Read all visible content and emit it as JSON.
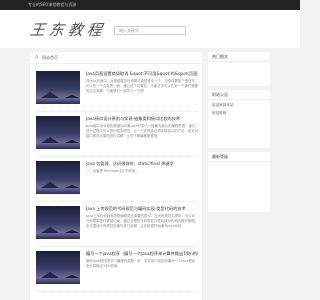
{
  "topbar": {
    "text": "专业的SEO课程教程与资源"
  },
  "header": {
    "logo": "王东教程",
    "search_placeholder": "输入关键字"
  },
  "breadcrumb": {
    "label": "网站首页"
  },
  "posts": [
    {
      "title": "Java页面设置商如取消 &quot;不可用&quot;的&quot;页面和&quot;按钮不能使用",
      "excerpt": "在Java页面中，对按钮框进行设置可能是其中一个，当你设置某个按钮不可以在一个交互的一面，通过这个设置后，不能点击可以达到一个我们想要的交互效果，下面我们一起学习一下吧"
    },
    {
      "title": "Java接口设计原则与实现-抽象类和接口比较的技术",
      "excerpt": "Java接口设计原则是面向对象Java开发中一种最为核心的编程思想，接口设计过程中可以进行很多规范，让一个实现类必须实现接口的方法，本文对接口的设计原则进行讲解，让你了解编程更规范。"
    },
    {
      "title": "java 包管理、访问修饰符、static/final 关键字",
      "excerpt": "一、包管理 Package(包) 的作用..."
    },
    {
      "title": "Java 上传规范的代码规范与编码实现-类型代码的技术",
      "excerpt": "Java上传的代码规范是编程语言重要的部分，在代码规范实现时，可以对代码框架进行规范约束，通过合理的代码规范方便后续对代码的维护管理。本文围绕代码规范的编写进行讲解，让你能更好地编写Java代码。"
    },
    {
      "title": "编写一个java程序（编写一个Java程序来计算并输出1到n的和）",
      "excerpt": "编写Java程序是学习编程的重要一步，本文将介绍如何编写一个Java程序来计算输出1到n的和。"
    }
  ],
  "sidebar": {
    "latest_title": "热门图文",
    "recommend_title": "阿站公告",
    "recommend_items": [
      "欢迎来到本站",
      "阿站推荐"
    ],
    "tags_title": "最新等级"
  }
}
